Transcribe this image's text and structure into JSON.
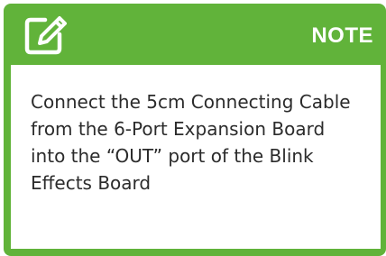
{
  "note": {
    "title": "NOTE",
    "icon": "edit-note-icon",
    "text": "Connect the 5cm Connecting Cable from the 6-Port Expansion Board into the “OUT” port of the Blink Effects Board"
  },
  "colors": {
    "accent": "#61b33a",
    "body_background": "#ffffff",
    "text": "#2b2b2b"
  }
}
